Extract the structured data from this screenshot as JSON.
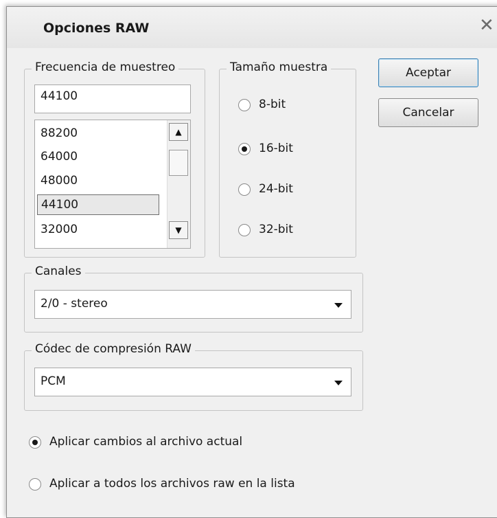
{
  "dialog": {
    "title": "Opciones RAW",
    "close_glyph": "✕"
  },
  "sample_rate": {
    "legend": "Frecuencia de muestreo",
    "value": "44100",
    "options": [
      "88200",
      "64000",
      "48000",
      "44100",
      "32000"
    ],
    "selected": "44100"
  },
  "sample_size": {
    "legend": "Tamaño muestra",
    "options": [
      {
        "label": "8-bit",
        "checked": false
      },
      {
        "label": "16-bit",
        "checked": true
      },
      {
        "label": "24-bit",
        "checked": false
      },
      {
        "label": "32-bit",
        "checked": false
      }
    ]
  },
  "buttons": {
    "ok": "Aceptar",
    "cancel": "Cancelar"
  },
  "channels": {
    "legend": "Canales",
    "value": "2/0 - stereo"
  },
  "codec": {
    "legend": "Códec de compresión RAW",
    "value": "PCM"
  },
  "apply": {
    "options": [
      {
        "label": "Aplicar cambios al archivo actual",
        "checked": true
      },
      {
        "label": "Aplicar a todos los archivos raw en la lista",
        "checked": false
      }
    ]
  },
  "icons": {
    "scroll_up": "▲",
    "scroll_down": "▼"
  }
}
